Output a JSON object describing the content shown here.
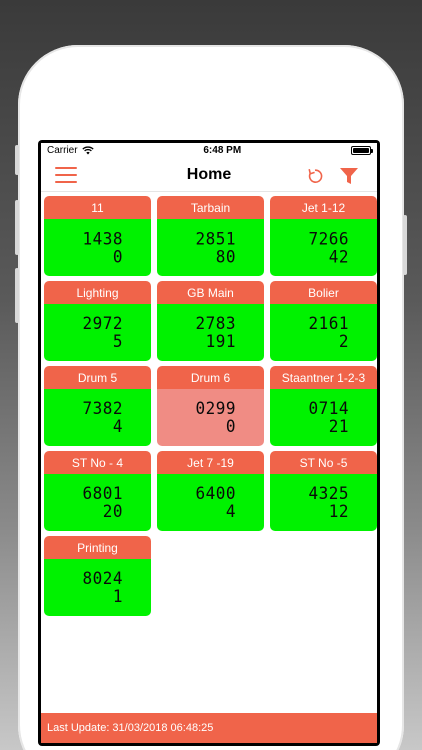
{
  "status": {
    "carrier": "Carrier",
    "time": "6:48 PM"
  },
  "nav": {
    "title": "Home"
  },
  "tiles": [
    {
      "name": "11",
      "value1": "1438",
      "value2": "0",
      "state": "ok"
    },
    {
      "name": "Tarbain",
      "value1": "2851",
      "value2": "80",
      "state": "ok"
    },
    {
      "name": "Jet 1-12",
      "value1": "7266",
      "value2": "42",
      "state": "ok"
    },
    {
      "name": "Lighting",
      "value1": "2972",
      "value2": "5",
      "state": "ok"
    },
    {
      "name": "GB Main",
      "value1": "2783",
      "value2": "191",
      "state": "ok"
    },
    {
      "name": "Bolier",
      "value1": "2161",
      "value2": "2",
      "state": "ok"
    },
    {
      "name": "Drum 5",
      "value1": "7382",
      "value2": "4",
      "state": "ok"
    },
    {
      "name": "Drum 6",
      "value1": "0299",
      "value2": "0",
      "state": "alert"
    },
    {
      "name": "Staantner 1-2-3",
      "value1": "0714",
      "value2": "21",
      "state": "ok"
    },
    {
      "name": "ST No - 4",
      "value1": "6801",
      "value2": "20",
      "state": "ok"
    },
    {
      "name": "Jet 7 -19",
      "value1": "6400",
      "value2": "4",
      "state": "ok"
    },
    {
      "name": "ST No -5",
      "value1": "4325",
      "value2": "12",
      "state": "ok"
    },
    {
      "name": "Printing",
      "value1": "8024",
      "value2": "1",
      "state": "ok"
    }
  ],
  "footer": {
    "text": "Last Update: 31/03/2018 06:48:25"
  },
  "colors": {
    "accent": "#f0644a",
    "ok": "#00f200",
    "alert": "#f08c84"
  },
  "icons": {
    "menu": "hamburger-icon",
    "refresh": "refresh-icon",
    "filter": "filter-icon"
  }
}
